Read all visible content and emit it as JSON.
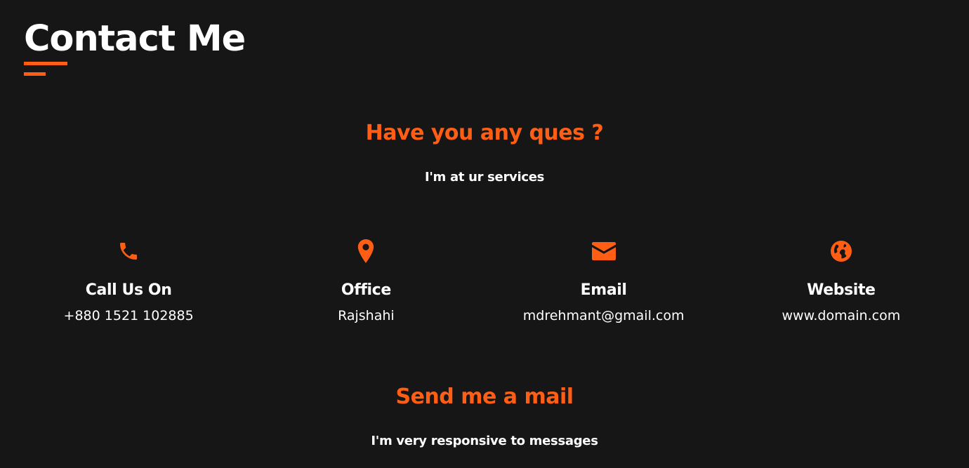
{
  "section": {
    "title": "Contact Me",
    "accent_color": "#ff5e14"
  },
  "intro": {
    "heading": "Have you any ques ?",
    "subheading": "I'm at ur services"
  },
  "contact_items": [
    {
      "icon": "phone-icon",
      "label": "Call Us On",
      "value": "+880 1521 102885"
    },
    {
      "icon": "map-marker-icon",
      "label": "Office",
      "value": "Rajshahi"
    },
    {
      "icon": "envelope-icon",
      "label": "Email",
      "value": "mdrehmant@gmail.com"
    },
    {
      "icon": "globe-icon",
      "label": "Website",
      "value": "www.domain.com"
    }
  ],
  "mail": {
    "heading": "Send me a mail",
    "subheading": "I'm very responsive to messages"
  }
}
